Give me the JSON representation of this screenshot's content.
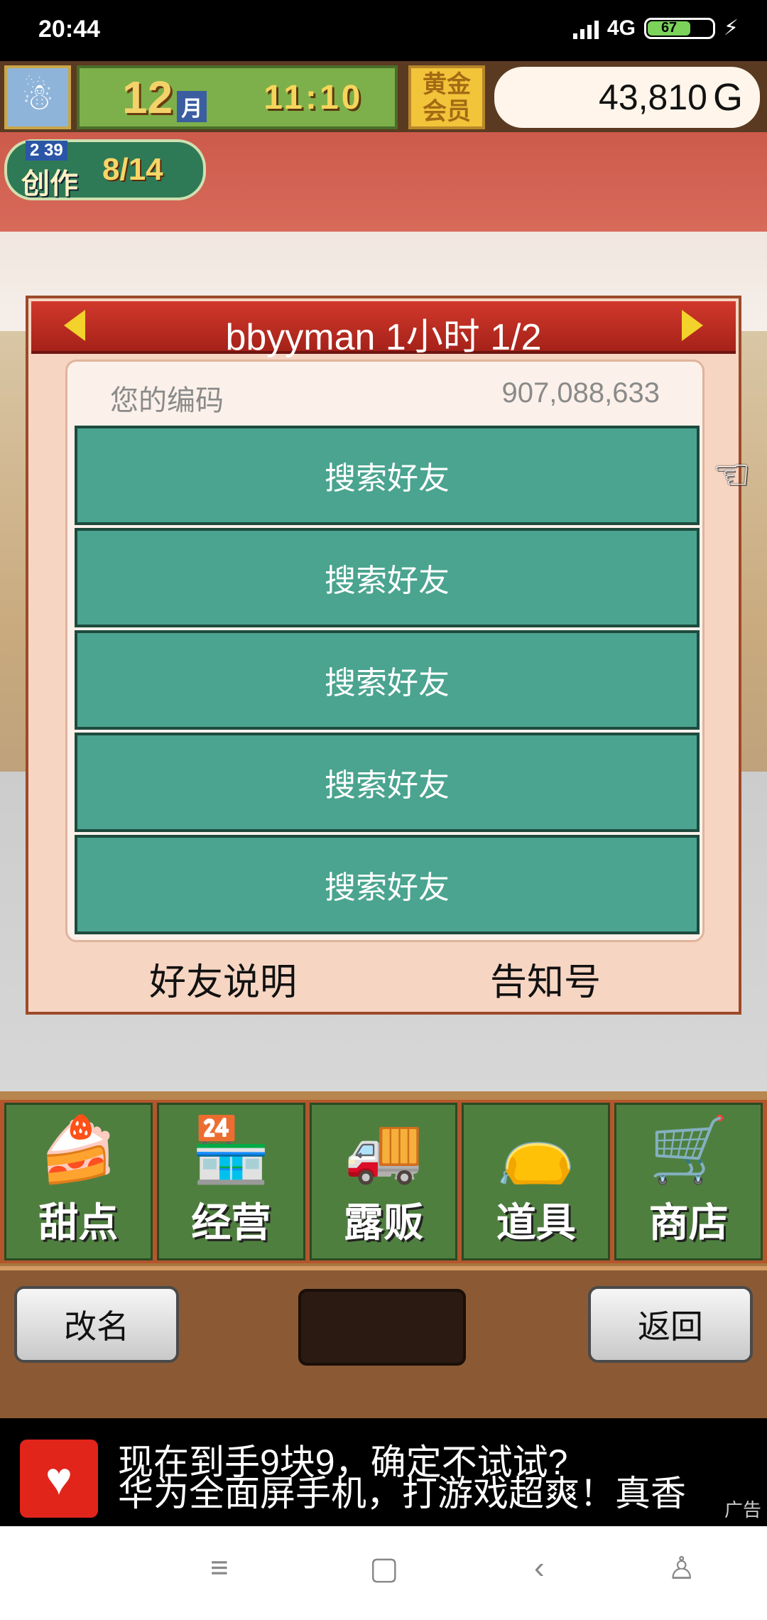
{
  "status": {
    "time": "20:44",
    "network": "4G",
    "battery": "67"
  },
  "topbar": {
    "month_number": "12",
    "month_label": "月",
    "time": "11:10",
    "gold_badge": "黄金会员",
    "money": "43,810",
    "money_unit": "G"
  },
  "create_badge": {
    "small": "2 39",
    "label": "创作",
    "count": "8/14"
  },
  "dialog": {
    "title": "bbyyman  1小时 1/2",
    "code_label": "您的编码",
    "code_value": "907,088,633",
    "slots": [
      "搜索好友",
      "搜索好友",
      "搜索好友",
      "搜索好友",
      "搜索好友"
    ],
    "footer_left": "好友说明",
    "footer_right": "告知号"
  },
  "menu": {
    "items": [
      {
        "label": "甜点",
        "icon": "cake-icon"
      },
      {
        "label": "经营",
        "icon": "shop-icon"
      },
      {
        "label": "露贩",
        "icon": "food-truck-icon"
      },
      {
        "label": "道具",
        "icon": "item-bag-icon"
      },
      {
        "label": "商店",
        "icon": "shopping-cart-icon"
      }
    ]
  },
  "bottom": {
    "rename_label": "改名",
    "back_label": "返回"
  },
  "ad": {
    "line1": "现在到手9块9，确定不试试?",
    "line2": "华为全面屏手机，打游戏超爽！真香",
    "tag": "广告"
  },
  "colors": {
    "slot_bg": "#4aa48f",
    "header_red": "#c12a20",
    "menu_green": "#4f7f3f"
  }
}
